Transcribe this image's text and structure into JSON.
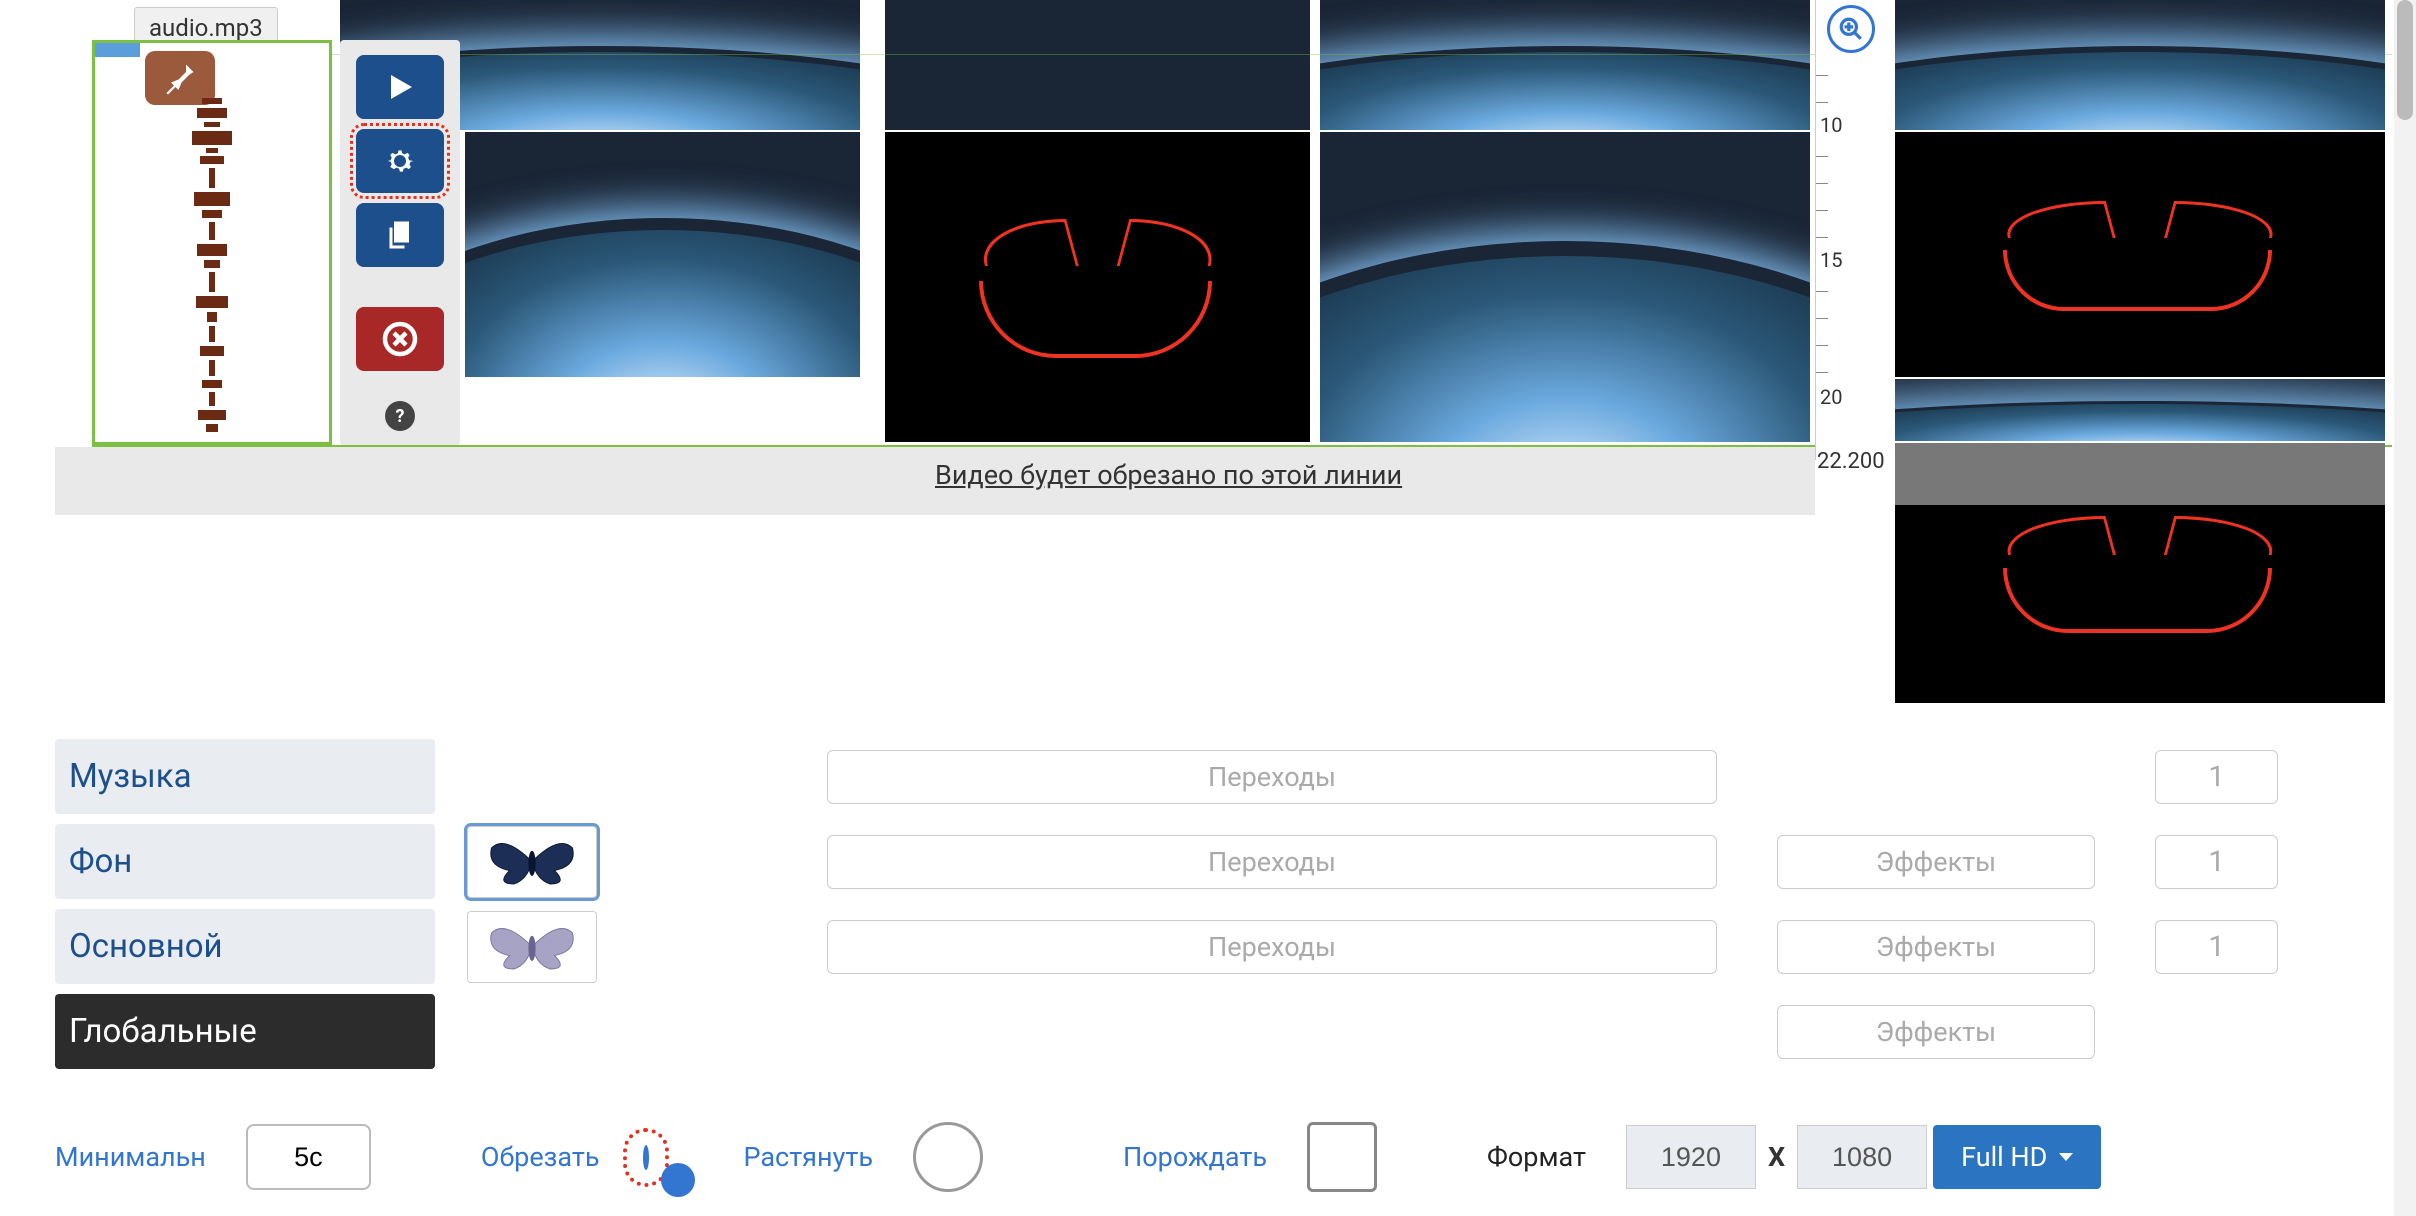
{
  "clip": {
    "filename": "audio.mp3"
  },
  "toolbar": {
    "play": "play-icon",
    "settings": "gear-icon",
    "copy": "copy-icon",
    "delete": "close-icon",
    "help": "?"
  },
  "ruler": {
    "ticks": [
      "10",
      "15",
      "20"
    ],
    "end": "22.200"
  },
  "cut_message": "Видео будет обрезано по этой линии",
  "layers": {
    "music": "Музыка",
    "background": "Фон",
    "main": "Основной",
    "global": "Глобальные"
  },
  "buttons": {
    "transitions": "Переходы",
    "effects": "Эффекты"
  },
  "counts": {
    "row1": "1",
    "row2": "1",
    "row3": "1"
  },
  "options": {
    "minimal_label": "Минимальн",
    "minimal_value": "5с",
    "crop_label": "Обрезать",
    "stretch_label": "Растянуть",
    "spawn_label": "Порождать",
    "format_label": "Формат",
    "width": "1920",
    "x": "X",
    "height": "1080",
    "preset": "Full HD"
  },
  "zoom": "zoom-in-icon"
}
